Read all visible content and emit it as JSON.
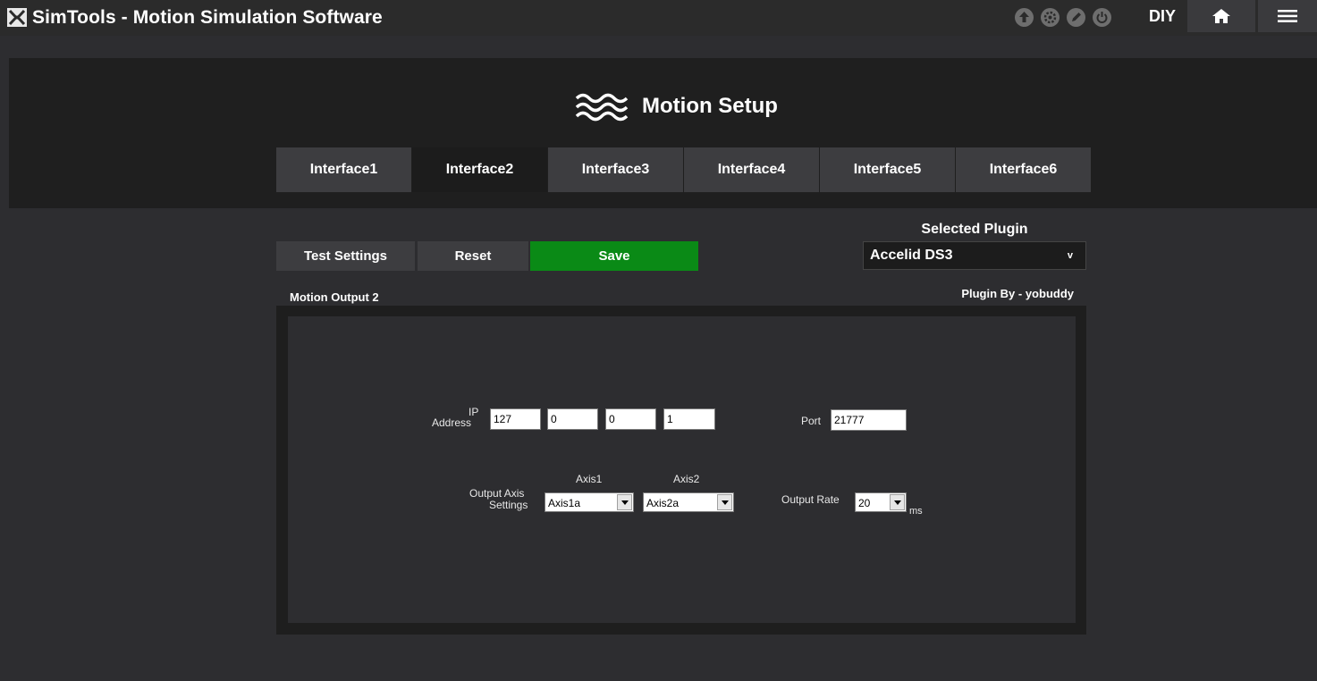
{
  "app": {
    "title": "SimTools - Motion Simulation Software",
    "mode_label": "DIY",
    "toolbar_icons": [
      "upload-icon",
      "settings-gear-icon",
      "edit-pencil-icon",
      "power-icon"
    ],
    "home_icon": "home-icon",
    "menu_icon": "hamburger-menu-icon"
  },
  "page": {
    "title": "Motion Setup",
    "icon": "waves-icon"
  },
  "tabs": [
    {
      "label": "Interface1",
      "active": false
    },
    {
      "label": "Interface2",
      "active": true
    },
    {
      "label": "Interface3",
      "active": false
    },
    {
      "label": "Interface4",
      "active": false
    },
    {
      "label": "Interface5",
      "active": false
    },
    {
      "label": "Interface6",
      "active": false
    }
  ],
  "toolbar": {
    "test_label": "Test Settings",
    "reset_label": "Reset",
    "save_label": "Save"
  },
  "plugin": {
    "selected_label": "Selected Plugin",
    "selected_value": "Accelid DS3",
    "caret": "v",
    "output_label": "Motion Output 2",
    "author_label": "Plugin By - yobuddy"
  },
  "settings": {
    "ip_label_line1": "IP",
    "ip_label_line2": "Address",
    "ip": [
      "127",
      "0",
      "0",
      "1"
    ],
    "port_label": "Port",
    "port": "21777",
    "axis_label_line1": "Output Axis",
    "axis_label_line2": "Settings",
    "axis1_header": "Axis1",
    "axis2_header": "Axis2",
    "axis1_value": "Axis1a",
    "axis2_value": "Axis2a",
    "rate_label": "Output Rate",
    "rate_value": "20",
    "rate_unit": "ms"
  },
  "colors": {
    "background": "#2d2d30",
    "header_panel": "#1f1f1f",
    "tab": "#3d3d40",
    "tab_active": "#1c1c1c",
    "save": "#0a8a16"
  }
}
